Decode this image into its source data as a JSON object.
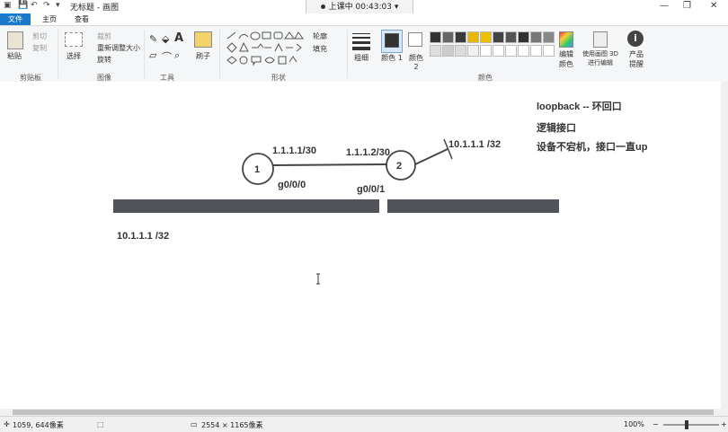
{
  "window": {
    "title": "无标题 - 画图",
    "recording": "上课中 00:43:03",
    "minimize": "—",
    "maximize": "❐",
    "close": "✕"
  },
  "tabs": [
    "文件",
    "主页",
    "查看"
  ],
  "ribbon": {
    "clipboard": {
      "paste": "粘贴",
      "cut": "剪切",
      "copy": "复制",
      "group": "剪贴板"
    },
    "image": {
      "select": "选择",
      "crop": "裁剪",
      "resize": "重新调整大小",
      "rotate": "旋转",
      "group": "图像"
    },
    "tools": {
      "group": "工具",
      "text_tool": "A"
    },
    "brushes": "刷子",
    "shapes": {
      "outline": "轮廓",
      "fill": "填充",
      "group": "形状"
    },
    "size": "粗细",
    "color1": "颜色 1",
    "color2": "颜色 2",
    "colors": {
      "edit": "编辑颜色",
      "paint3d": "使用画图 3D 进行编辑",
      "product_alert": "产品提醒",
      "group": "颜色"
    },
    "palette": [
      "#333333",
      "#666666",
      "#3a3a3a",
      "#e8b800",
      "#f0c000",
      "#444444",
      "#555555",
      "#333333",
      "#777777",
      "#888888",
      "#dddddd",
      "#cccccc",
      "#dcdcdc",
      "#f0f0f0",
      "#ffffff",
      "#ffffff",
      "#ffffff",
      "#ffffff",
      "#ffffff",
      "#ffffff"
    ]
  },
  "canvas": {
    "node1": "1",
    "node2": "2",
    "label_ip1": "1.1.1.1/30",
    "label_ip2": "1.1.1.2/30",
    "label_g000": "g0/0/0",
    "label_g001": "g0/0/1",
    "label_loop_ip": "10.1.1.1 /32",
    "label_bottom_ip": "10.1.1.1 /32",
    "note_title": "loopback -- 环回口",
    "note_logic": "逻辑接口",
    "note_up": "设备不宕机，接口一直up"
  },
  "status": {
    "cursor": "1059, 644像素",
    "dimensions": "2554 × 1165像素",
    "zoom": "100%"
  }
}
